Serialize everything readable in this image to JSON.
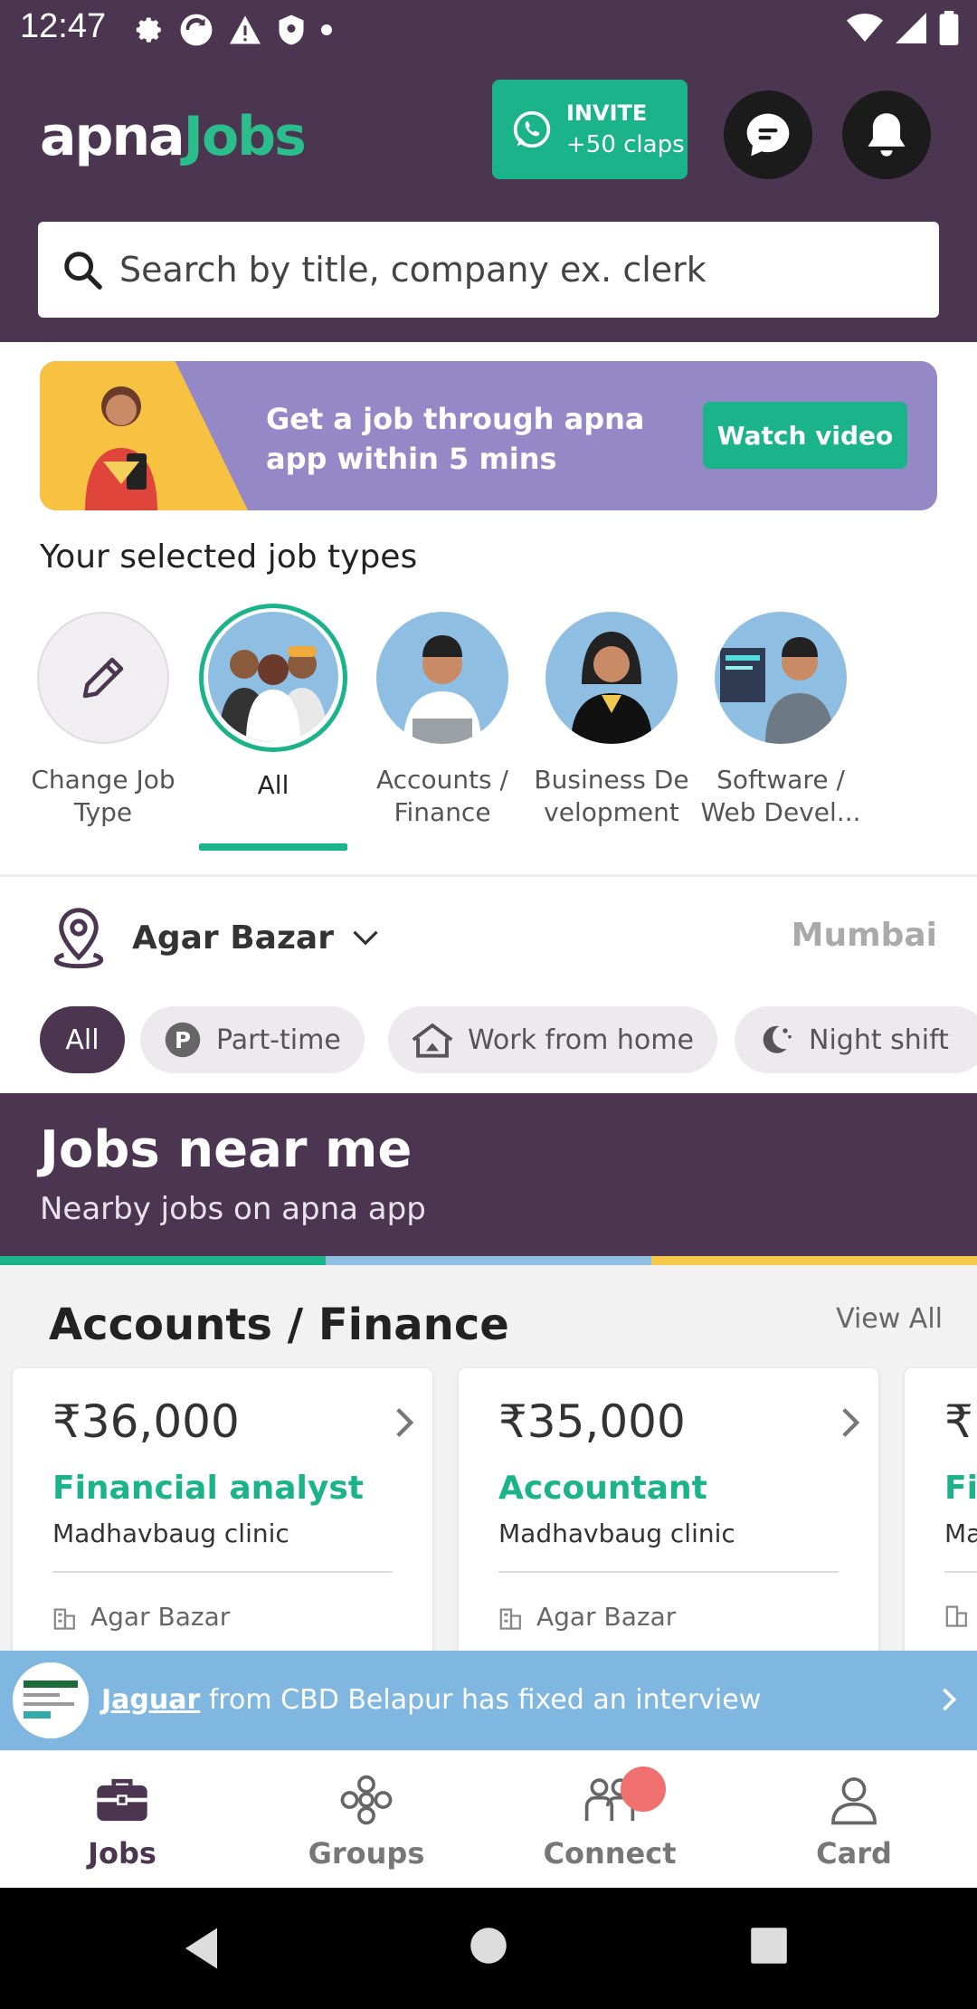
{
  "status": {
    "time": "12:47"
  },
  "header": {
    "logo_part1": "apna",
    "logo_part2": "Jobs",
    "invite_line1": "INVITE",
    "invite_line2": "+50 claps"
  },
  "search": {
    "placeholder": "Search by title, company ex. clerk"
  },
  "banner": {
    "text": "Get a job through apna app within 5 mins",
    "button": "Watch video"
  },
  "job_types": {
    "title": "Your selected job types",
    "items": [
      {
        "label": "Change Job Type"
      },
      {
        "label": "All"
      },
      {
        "label": "Accounts / Finance"
      },
      {
        "label": "Business De velopment"
      },
      {
        "label": "Software / Web Devel..."
      }
    ]
  },
  "location": {
    "area": "Agar Bazar",
    "city": "Mumbai"
  },
  "filters": [
    "All",
    "Part-time",
    "Work from home",
    "Night shift"
  ],
  "near": {
    "title": "Jobs near me",
    "subtitle": "Nearby jobs on apna app"
  },
  "colors": {
    "primary": "#4b3550",
    "accent": "#1ab38a",
    "stripe2": "#8ebfe3",
    "stripe3": "#f7c94b"
  },
  "jobs_section": {
    "title": "Accounts / Finance",
    "view_all": "View All",
    "cards": [
      {
        "salary": "₹36,000",
        "role": "Financial analyst",
        "company": "Madhavbaug clinic",
        "place": "Agar Bazar"
      },
      {
        "salary": "₹35,000",
        "role": "Accountant",
        "company": "Madhavbaug clinic",
        "place": "Agar Bazar"
      },
      {
        "salary": "₹",
        "role": "Fi",
        "company": "Ma",
        "place": ""
      }
    ]
  },
  "notification": {
    "company": "Jaguar",
    "text": " from CBD Belapur has fixed an interview"
  },
  "bottom_nav": [
    "Jobs",
    "Groups",
    "Connect",
    "Card"
  ]
}
